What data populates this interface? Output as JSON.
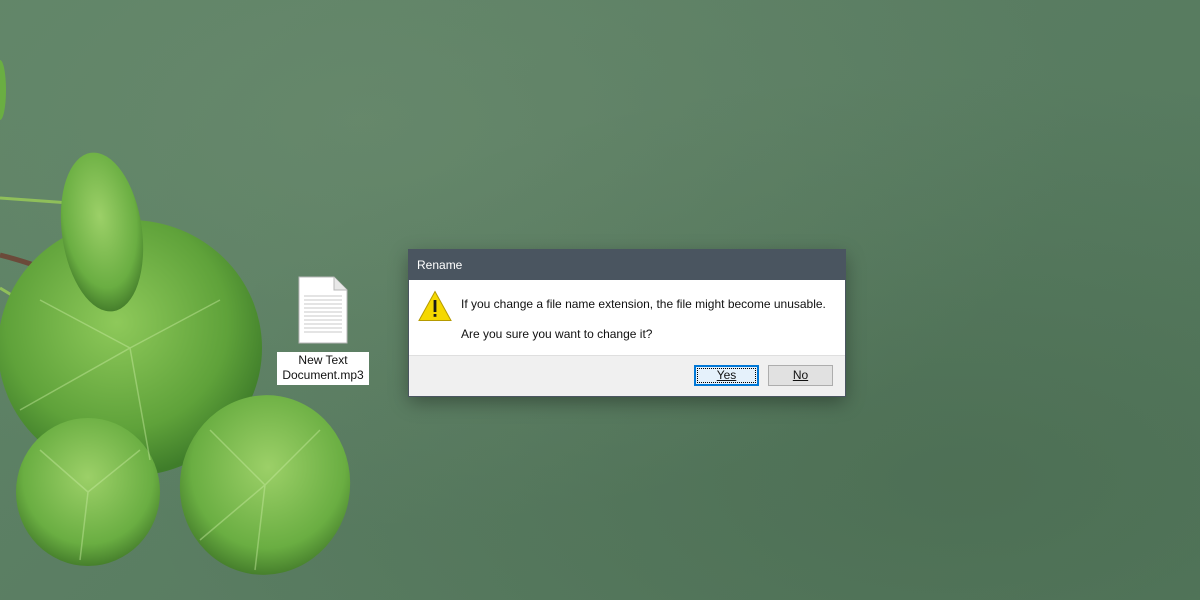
{
  "desktop": {
    "file_icon": {
      "icon": "text-document-icon",
      "label_line1": "New Text",
      "label_line2": "Document.mp3"
    }
  },
  "dialog": {
    "title": "Rename",
    "icon": "warning-icon",
    "message_line1": "If you change a file name extension, the file might become unusable.",
    "message_line2": "Are you sure you want to change it?",
    "buttons": {
      "yes": "Yes",
      "no": "No"
    }
  },
  "colors": {
    "title_bar": "#4a5560",
    "desktop_green": "#5a7d62",
    "warning_yellow": "#f5d800",
    "focus_blue": "#0078d7"
  }
}
